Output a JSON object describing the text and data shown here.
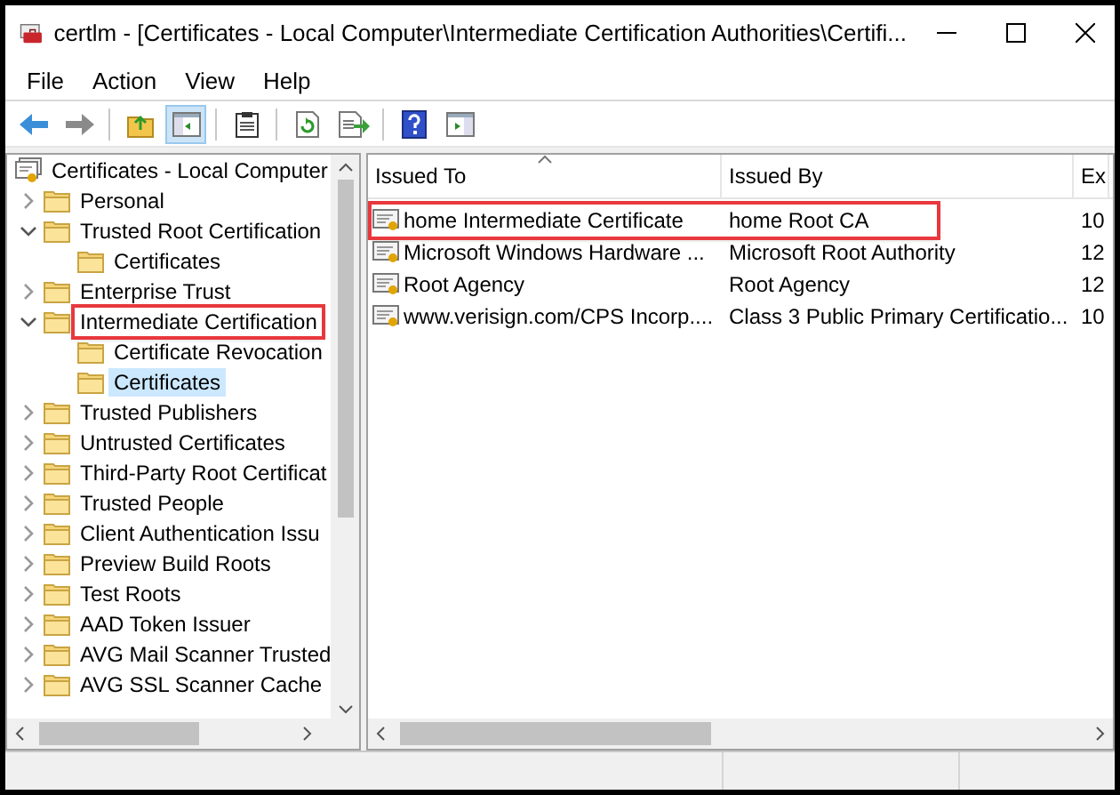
{
  "window": {
    "title": "certlm - [Certificates - Local Computer\\Intermediate Certification Authorities\\Certifi..."
  },
  "menu": [
    "File",
    "Action",
    "View",
    "Help"
  ],
  "toolbar": [
    {
      "kind": "back",
      "pressed": false
    },
    {
      "kind": "forward",
      "pressed": false
    },
    {
      "kind": "up",
      "pressed": false
    },
    {
      "kind": "tree",
      "pressed": true
    },
    {
      "kind": "properties",
      "pressed": false
    },
    {
      "kind": "refresh",
      "pressed": false
    },
    {
      "kind": "export",
      "pressed": false
    },
    {
      "kind": "help",
      "pressed": false
    },
    {
      "kind": "console",
      "pressed": false
    }
  ],
  "tree": {
    "label": "Certificates - Local Computer",
    "children": [
      {
        "label": "Personal",
        "expanded": false,
        "selected": false,
        "highlighted": false
      },
      {
        "label": "Trusted Root Certification",
        "expanded": true,
        "selected": false,
        "highlighted": false,
        "children": [
          {
            "label": "Certificates",
            "selected": false,
            "highlighted": false
          }
        ]
      },
      {
        "label": "Enterprise Trust",
        "expanded": false,
        "selected": false,
        "highlighted": false
      },
      {
        "label": "Intermediate Certification",
        "expanded": true,
        "selected": false,
        "highlighted": true,
        "children": [
          {
            "label": "Certificate Revocation",
            "selected": false,
            "highlighted": false
          },
          {
            "label": "Certificates",
            "selected": true,
            "highlighted": false
          }
        ]
      },
      {
        "label": "Trusted Publishers",
        "expanded": false,
        "selected": false,
        "highlighted": false
      },
      {
        "label": "Untrusted Certificates",
        "expanded": false,
        "selected": false,
        "highlighted": false
      },
      {
        "label": "Third-Party Root Certificat",
        "expanded": false,
        "selected": false,
        "highlighted": false
      },
      {
        "label": "Trusted People",
        "expanded": false,
        "selected": false,
        "highlighted": false
      },
      {
        "label": "Client Authentication Issu",
        "expanded": false,
        "selected": false,
        "highlighted": false
      },
      {
        "label": "Preview Build Roots",
        "expanded": false,
        "selected": false,
        "highlighted": false
      },
      {
        "label": "Test Roots",
        "expanded": false,
        "selected": false,
        "highlighted": false
      },
      {
        "label": "AAD Token Issuer",
        "expanded": false,
        "selected": false,
        "highlighted": false
      },
      {
        "label": "AVG Mail Scanner Trusted",
        "expanded": false,
        "selected": false,
        "highlighted": false
      },
      {
        "label": "AVG SSL Scanner Cache",
        "expanded": false,
        "selected": false,
        "highlighted": false
      }
    ]
  },
  "table": {
    "columns": [
      {
        "label": "Issued To",
        "sorted": true
      },
      {
        "label": "Issued By",
        "sorted": false
      },
      {
        "label": "Ex",
        "sorted": false
      }
    ],
    "rows": [
      {
        "issued_to": "home Intermediate Certificate",
        "issued_by": "home Root CA",
        "column_3": "10",
        "highlighted": true
      },
      {
        "issued_to": "Microsoft Windows Hardware ...",
        "issued_by": "Microsoft Root Authority",
        "column_3": "12",
        "highlighted": false
      },
      {
        "issued_to": "Root Agency",
        "issued_by": "Root Agency",
        "column_3": "12",
        "highlighted": false
      },
      {
        "issued_to": "www.verisign.com/CPS Incorp....",
        "issued_by": "Class 3 Public Primary Certificatio...",
        "column_3": "10",
        "highlighted": false
      }
    ]
  }
}
